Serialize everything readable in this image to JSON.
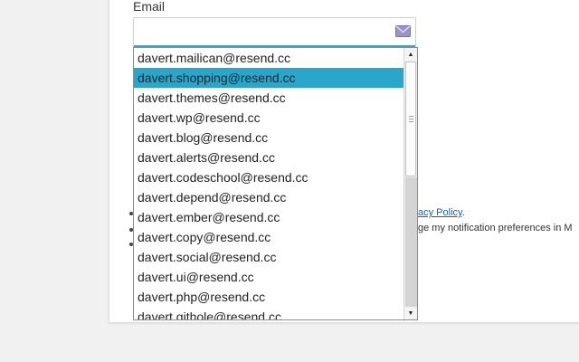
{
  "form": {
    "email_label": "Email",
    "email_value": ""
  },
  "background": {
    "policy_link": "acy Policy",
    "policy_period": ".",
    "notification_text": "ge my notification preferences in M"
  },
  "dropdown": {
    "selected_index": 1,
    "items": [
      "davert.mailican@resend.cc",
      "davert.shopping@resend.cc",
      "davert.themes@resend.cc",
      "davert.wp@resend.cc",
      "davert.blog@resend.cc",
      "davert.alerts@resend.cc",
      "davert.codeschool@resend.cc",
      "davert.depend@resend.cc",
      "davert.ember@resend.cc",
      "davert.copy@resend.cc",
      "davert.social@resend.cc",
      "davert.ui@resend.cc",
      "davert.php@resend.cc",
      "davert.githole@resend.cc"
    ]
  },
  "icons": {
    "email_field_icon": "envelope-icon"
  },
  "colors": {
    "selection": "#2aa6cb",
    "field_focus_border": "#3aa3c8"
  }
}
